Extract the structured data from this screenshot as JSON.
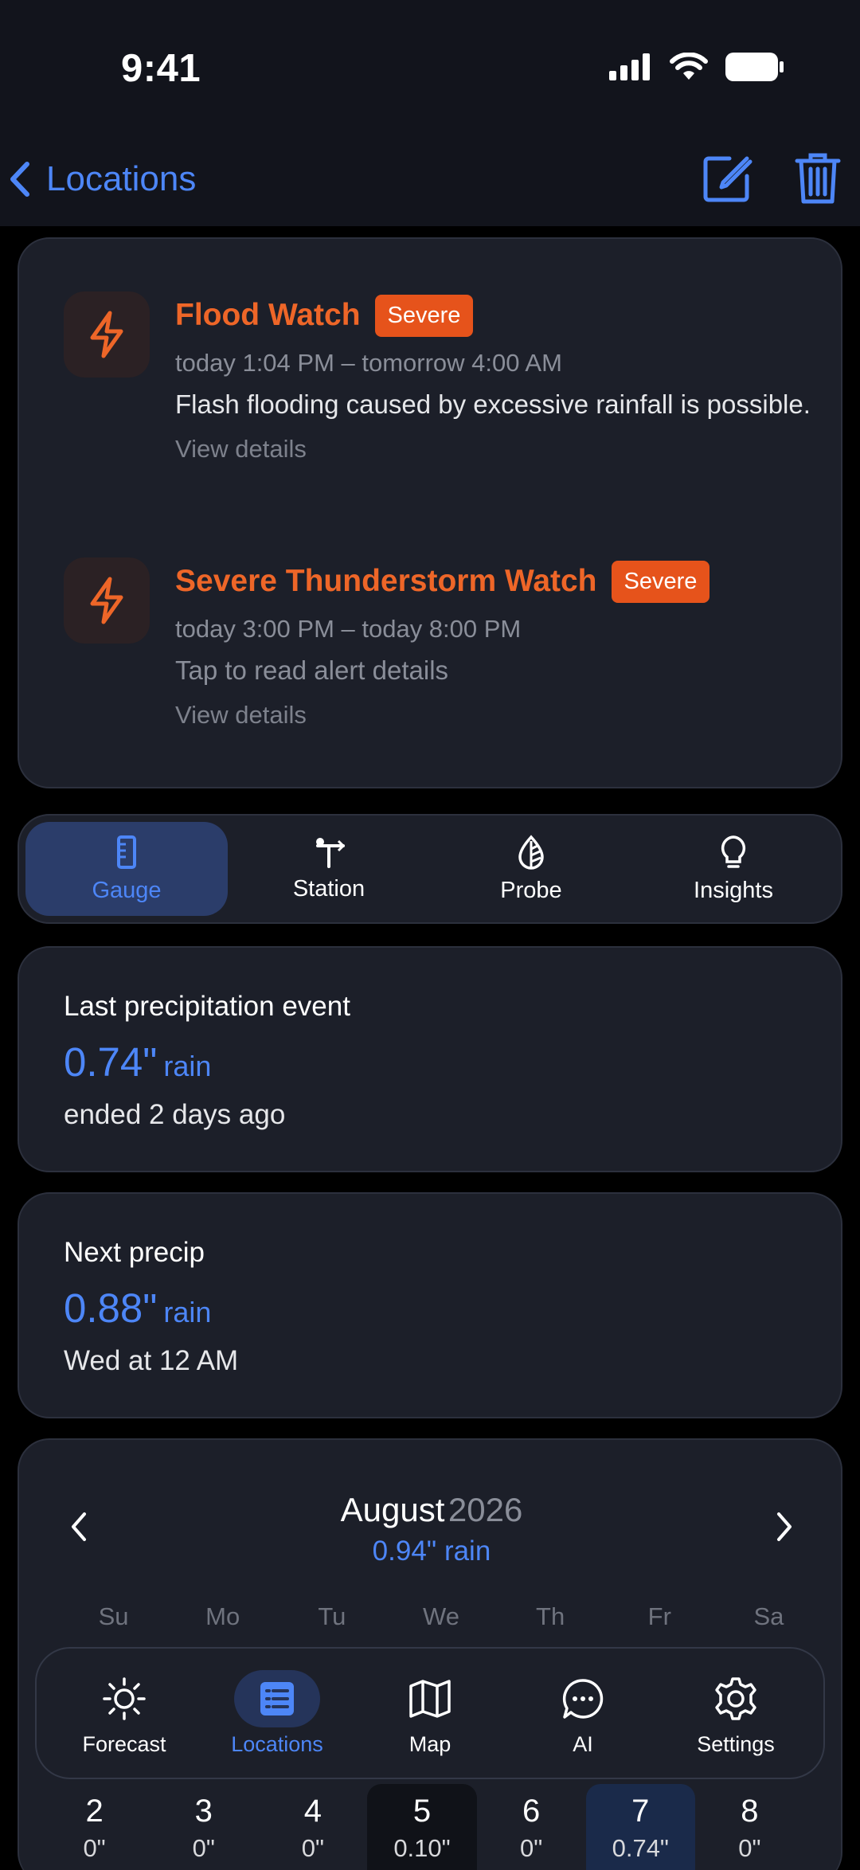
{
  "status": {
    "time": "9:41"
  },
  "nav": {
    "back_label": "Locations"
  },
  "alerts": [
    {
      "title": "Flood Watch",
      "badge": "Severe",
      "time": "today 1:04 PM – tomorrow 4:00 AM",
      "description": "Flash flooding caused by excessive rainfall is possible.",
      "link": "View details"
    },
    {
      "title": "Severe Thunderstorm Watch",
      "badge": "Severe",
      "time": "today 3:00 PM – today 8:00 PM",
      "description": "Tap to read alert details",
      "link": "View details"
    }
  ],
  "segments": [
    {
      "label": "Gauge",
      "icon": "ruler-icon",
      "active": true
    },
    {
      "label": "Station",
      "icon": "station-icon",
      "active": false
    },
    {
      "label": "Probe",
      "icon": "probe-icon",
      "active": false
    },
    {
      "label": "Insights",
      "icon": "lightbulb-icon",
      "active": false
    }
  ],
  "last_precip": {
    "label": "Last precipitation event",
    "value": "0.74\"",
    "unit": "rain",
    "sub": "ended 2 days ago"
  },
  "next_precip": {
    "label": "Next precip",
    "value": "0.88\"",
    "unit": "rain",
    "sub": "Wed at 12 AM"
  },
  "calendar": {
    "month": "August",
    "year": "2026",
    "total": "0.94\" rain",
    "weekdays": [
      "Su",
      "Mo",
      "Tu",
      "We",
      "Th",
      "Fr",
      "Sa"
    ],
    "days": [
      {
        "num": "2",
        "amt": "0\""
      },
      {
        "num": "3",
        "amt": "0\""
      },
      {
        "num": "4",
        "amt": "0\""
      },
      {
        "num": "5",
        "amt": "0.10\""
      },
      {
        "num": "6",
        "amt": "0\""
      },
      {
        "num": "7",
        "amt": "0.74\""
      },
      {
        "num": "8",
        "amt": "0\""
      }
    ]
  },
  "tabbar": [
    {
      "label": "Forecast",
      "icon": "sun-icon"
    },
    {
      "label": "Locations",
      "icon": "list-icon"
    },
    {
      "label": "Map",
      "icon": "map-icon"
    },
    {
      "label": "AI",
      "icon": "chat-icon"
    },
    {
      "label": "Settings",
      "icon": "gear-icon"
    }
  ],
  "colors": {
    "accent": "#4d86f7",
    "alert": "#ee6628",
    "badge": "#e6531b",
    "card": "#1c1f29"
  }
}
